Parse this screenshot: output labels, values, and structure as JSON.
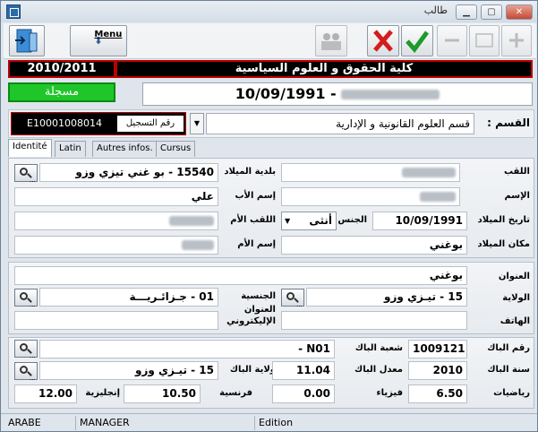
{
  "window": {
    "title": "طالب"
  },
  "toolbar": {
    "menu_label": "Menu"
  },
  "header": {
    "year": "2010/2011",
    "faculty": "كلية الحقوق و العلوم السياسية",
    "status": "مسجلة",
    "birth_date": "10/09/1991",
    "name_sep": "-",
    "reg_number": "E10001008014",
    "reg_label": "رقم التسجيل",
    "dept_label": "القسم :",
    "dept_value": "قسم العلوم القانونية و الإدارية"
  },
  "tabs": [
    "Identité",
    "Latin",
    "Autres infos.",
    "Cursus"
  ],
  "identity": {
    "lastname_label": "اللقب",
    "firstname_label": "الإسم",
    "birthdate_label": "تاريخ الميلاد",
    "birthdate_value": "10/09/1991",
    "birthplace_label": "مكان الميلاد",
    "birthplace_value": "بوغني",
    "gender_label": "الجنس",
    "gender_value": "أنثى",
    "mother_lastname_label": "اللقب الأم",
    "father_name_label": "إسم الأب",
    "father_name_value": "علي",
    "mother_name_label": "إسم الأم",
    "birth_commune_label": "بلدية الميلاد",
    "birth_commune_value": "15540 - بو غني تيزي وزو"
  },
  "address": {
    "address_label": "العنوان",
    "address_value": "بوغني",
    "wilaya_label": "الولاية",
    "wilaya_value": "15 - تيـزي وزو",
    "nationality_label": "الجنسية",
    "nationality_value": "01 - جـزائـريـــة",
    "email_label": "العنوان الإليكتروني",
    "phone_label": "الهاتف"
  },
  "bac": {
    "num_label": "رقم الباك",
    "num_value": "1009121",
    "branch_label": "شعبة الباك",
    "branch_value": "N01 -",
    "year_label": "سنة الباك",
    "year_value": "2010",
    "avg_label": "معدل الباك",
    "avg_value": "11.04",
    "wilaya_label": "ولاية الباك",
    "wilaya_value": "15 - تيـزي وزو",
    "math_label": "رياضيات",
    "math_value": "6.50",
    "physics_label": "فيزياء",
    "physics_value": "0.00",
    "french_label": "فرنسية",
    "french_value": "10.50",
    "english_label": "إنجليزية",
    "english_value": "12.00"
  },
  "statusbar": {
    "lang": "ARABE",
    "user": "MANAGER",
    "mode": "Edition"
  }
}
